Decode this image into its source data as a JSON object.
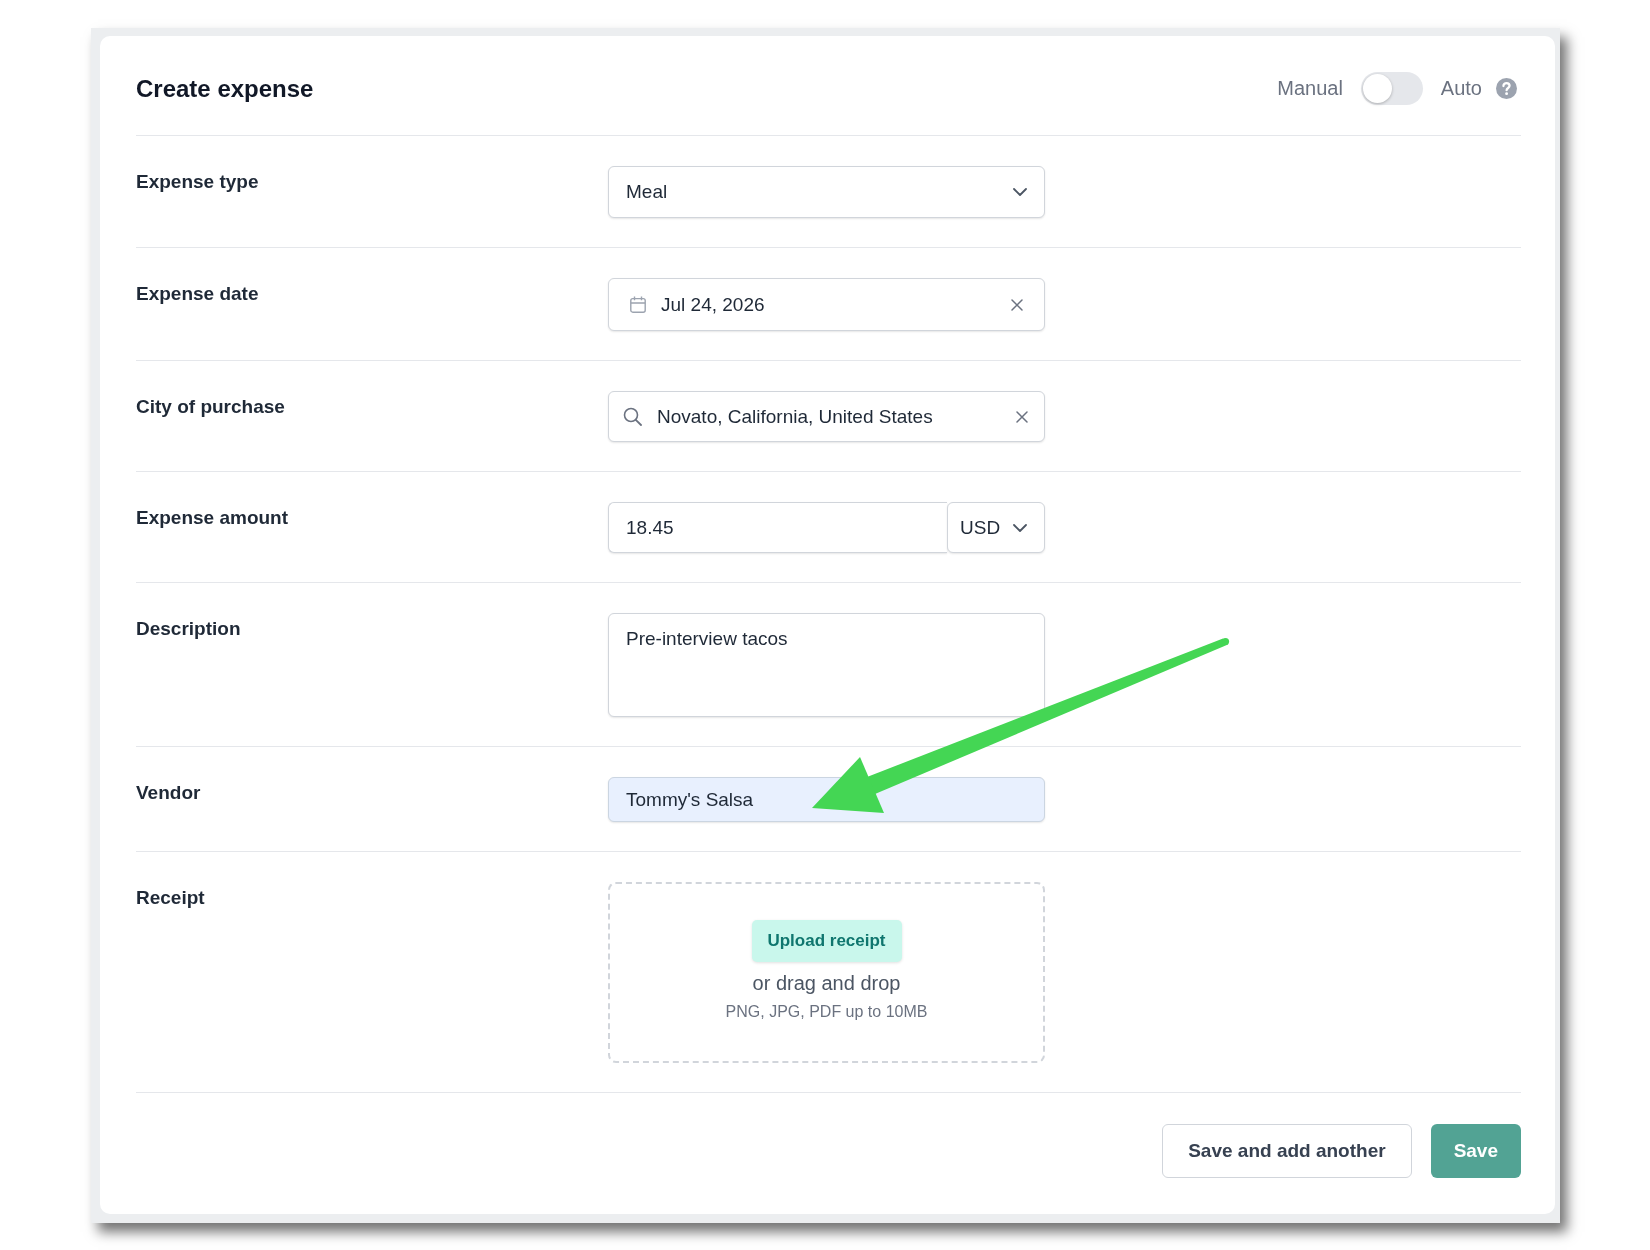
{
  "header": {
    "title": "Create expense",
    "mode_toggle": {
      "left_label": "Manual",
      "right_label": "Auto",
      "on": false
    }
  },
  "fields": [
    {
      "label": "Expense type",
      "kind": "select",
      "value": "Meal"
    },
    {
      "label": "Expense date",
      "kind": "date",
      "value": "Jul 24, 2026",
      "clearable": true
    },
    {
      "label": "City of purchase",
      "kind": "search",
      "value": "Novato, California, United States",
      "clearable": true
    },
    {
      "label": "Expense amount",
      "kind": "amount",
      "value": "18.45",
      "currency": "USD"
    },
    {
      "label": "Description",
      "kind": "textarea",
      "value": "Pre-interview tacos"
    },
    {
      "label": "Vendor",
      "kind": "text",
      "value": "Tommy's Salsa",
      "autofilled": true
    },
    {
      "label": "Receipt",
      "kind": "upload",
      "button": "Upload receipt",
      "hint": "or drag and drop",
      "note": "PNG, JPG, PDF up to 10MB"
    }
  ],
  "actions": [
    {
      "label": "Save and add another",
      "kind": "secondary"
    },
    {
      "label": "Save",
      "kind": "primary"
    }
  ],
  "annotations": [
    {
      "kind": "arrow"
    }
  ]
}
